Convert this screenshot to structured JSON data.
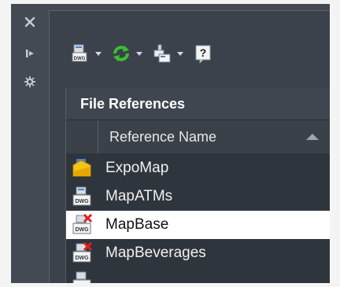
{
  "palette": {
    "close_icon": "close-icon",
    "pin_icon": "pin-icon",
    "settings_icon": "settings-icon"
  },
  "toolbar": {
    "items": [
      {
        "icon": "attach-dwg-icon",
        "has_dropdown": true
      },
      {
        "icon": "refresh-icon",
        "has_dropdown": true,
        "color": "#3cbf2e"
      },
      {
        "icon": "change-path-icon",
        "has_dropdown": true
      },
      {
        "icon": "help-icon",
        "has_dropdown": false
      }
    ]
  },
  "file_references": {
    "title": "File References",
    "column_header": "Reference Name",
    "rows": [
      {
        "name": "ExpoMap",
        "icon": "host-drawing-icon",
        "selected": false
      },
      {
        "name": "MapATMs",
        "icon": "dwg-file-icon",
        "selected": false
      },
      {
        "name": "MapBase",
        "icon": "dwg-file-not-found-icon",
        "selected": true
      },
      {
        "name": "MapBeverages",
        "icon": "dwg-file-not-found-icon",
        "selected": false
      },
      {
        "name": "",
        "icon": "dwg-file-icon",
        "selected": false
      }
    ]
  },
  "colors": {
    "panel_bg": "#3b424b",
    "list_bg": "#2f353c",
    "selected_bg": "#ffffff",
    "error_red": "#e02020"
  }
}
